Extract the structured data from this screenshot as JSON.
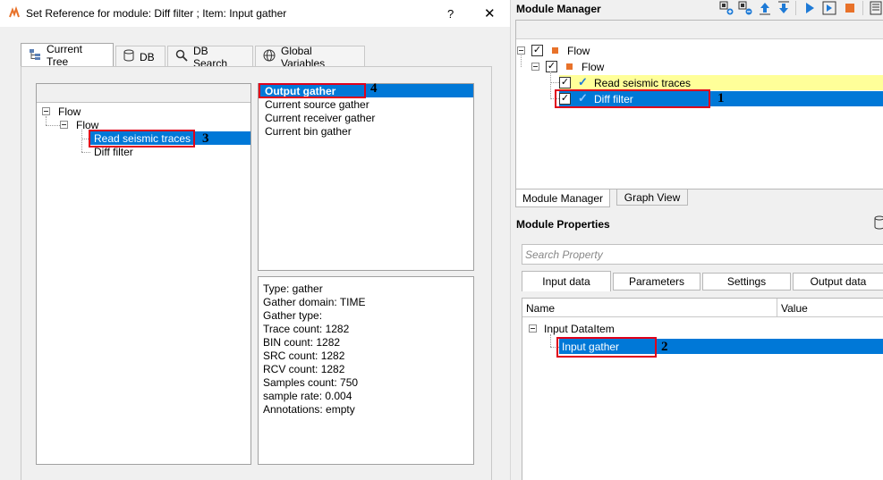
{
  "dialog": {
    "title": "Set Reference for module: Diff filter ; Item: Input gather",
    "help_label": "?",
    "close_label": "✕",
    "tabs": [
      {
        "label": "Current Tree"
      },
      {
        "label": "DB"
      },
      {
        "label": "DB Search"
      },
      {
        "label": "Global Variables"
      }
    ],
    "tree": {
      "root": "Flow",
      "child": "Flow",
      "items": [
        "Read seismic traces",
        "Diff filter"
      ]
    },
    "gathers": [
      "Output gather",
      "Current source gather",
      "Current receiver gather",
      "Current bin gather"
    ],
    "info": [
      "Type: gather",
      "Gather domain:   TIME",
      "Gather type:",
      "Trace count:    1282",
      "BIN count:     1282",
      "SRC count:     1282",
      "RCV count:     1282",
      "Samples count: 750",
      "sample rate:  0.004",
      "Annotations:  empty"
    ]
  },
  "markers": {
    "m1": "1",
    "m2": "2",
    "m3": "3",
    "m4": "4"
  },
  "module_manager": {
    "title": "Module Manager",
    "toolbar_icons": [
      "add-module-icon",
      "remove-module-icon",
      "move-up-icon",
      "move-down-icon",
      "run-icon",
      "step-icon",
      "stop-icon",
      "log-icon"
    ],
    "tree": {
      "root": "Flow",
      "child": "Flow",
      "items": [
        "Read seismic traces",
        "Diff filter"
      ]
    },
    "bottom_tabs": [
      "Module Manager",
      "Graph View"
    ]
  },
  "module_properties": {
    "title": "Module Properties",
    "search_placeholder": "Search Property",
    "tabs": [
      "Input data",
      "Parameters",
      "Settings",
      "Output data"
    ],
    "columns": [
      "Name",
      "Value"
    ],
    "group": "Input DataItem",
    "item": "Input gather"
  },
  "colors": {
    "selection": "#0078d7",
    "highlight_row": "#ffff99",
    "marker_red": "#e0001b",
    "flow_orange": "#e8722a"
  }
}
